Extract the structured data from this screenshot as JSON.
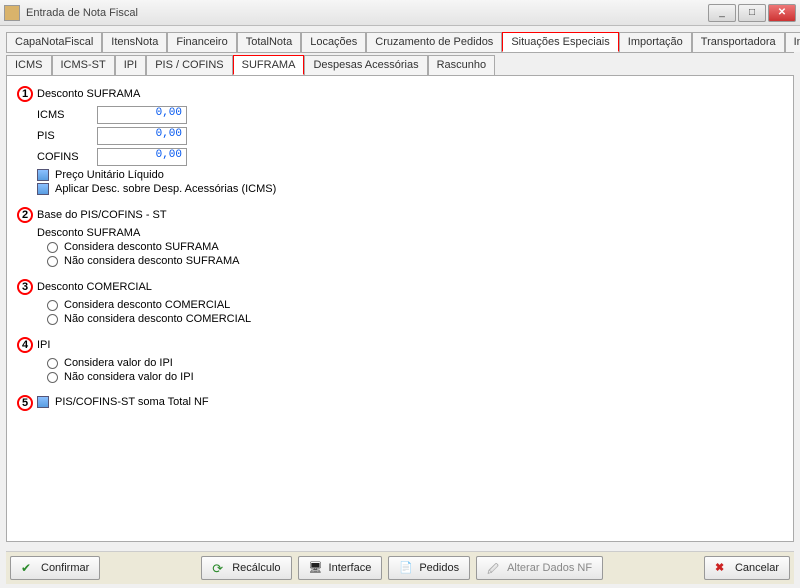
{
  "window": {
    "title": "Entrada de Nota Fiscal"
  },
  "tabs": [
    "CapaNotaFiscal",
    "ItensNota",
    "Financeiro",
    "TotalNota",
    "Locações",
    "Cruzamento de Pedidos",
    "Situações Especiais",
    "Importação",
    "Transportadora",
    "Informações Adicionais"
  ],
  "activeTab": "Situações Especiais",
  "subtabs": [
    "ICMS",
    "ICMS-ST",
    "IPI",
    "PIS / COFINS",
    "SUFRAMA",
    "Despesas Acessórias",
    "Rascunho"
  ],
  "activeSubtab": "SUFRAMA",
  "section1": {
    "badge": "1",
    "title": "Desconto SUFRAMA",
    "fields": {
      "icms_label": "ICMS",
      "icms_value": "0,00",
      "pis_label": "PIS",
      "pis_value": "0,00",
      "cofins_label": "COFINS",
      "cofins_value": "0,00"
    },
    "chk1": "Preço Unitário Líquido",
    "chk2": "Aplicar Desc. sobre Desp.  Acessórias (ICMS)"
  },
  "section2": {
    "badge": "2",
    "title": "Base do PIS/COFINS - ST",
    "groupA_title": "Desconto SUFRAMA",
    "groupA_r1": "Considera desconto SUFRAMA",
    "groupA_r2": "Não considera desconto SUFRAMA"
  },
  "section3": {
    "badge": "3",
    "title": "Desconto COMERCIAL",
    "r1": "Considera desconto COMERCIAL",
    "r2": "Não considera desconto COMERCIAL"
  },
  "section4": {
    "badge": "4",
    "title": "IPI",
    "r1": "Considera valor do IPI",
    "r2": "Não considera valor do IPI"
  },
  "section5": {
    "badge": "5",
    "chk": "PIS/COFINS-ST soma Total NF"
  },
  "footer": {
    "confirmar": "Confirmar",
    "recalculo": "Recálculo",
    "interface": "Interface",
    "pedidos": "Pedidos",
    "alterar": "Alterar Dados NF",
    "cancelar": "Cancelar"
  }
}
